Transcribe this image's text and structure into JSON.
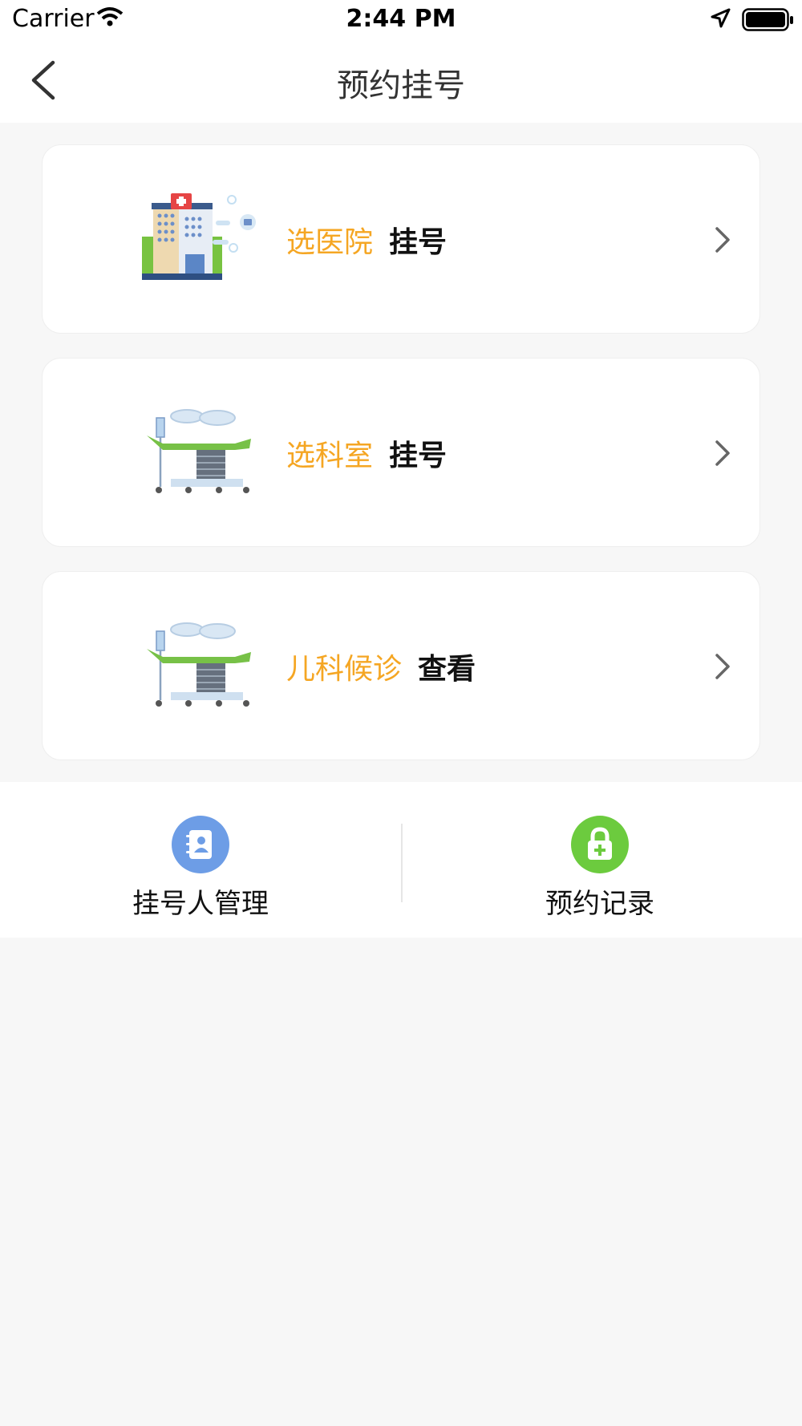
{
  "status_bar": {
    "carrier": "Carrier",
    "time": "2:44 PM"
  },
  "header": {
    "title": "预约挂号"
  },
  "cards": [
    {
      "accent": "选医院",
      "action": "挂号",
      "icon": "hospital-building-icon"
    },
    {
      "accent": "选科室",
      "action": "挂号",
      "icon": "surgery-room-icon"
    },
    {
      "accent": "儿科候诊",
      "action": "查看",
      "icon": "surgery-room-icon"
    }
  ],
  "bottom": {
    "left": {
      "label": "挂号人管理",
      "icon": "contact-book-icon"
    },
    "right": {
      "label": "预约记录",
      "icon": "lock-record-icon"
    }
  },
  "colors": {
    "accent": "#f5a623",
    "contacts_icon": "#6d9de6",
    "records_icon": "#6ccb3e",
    "background": "#f7f7f7"
  }
}
